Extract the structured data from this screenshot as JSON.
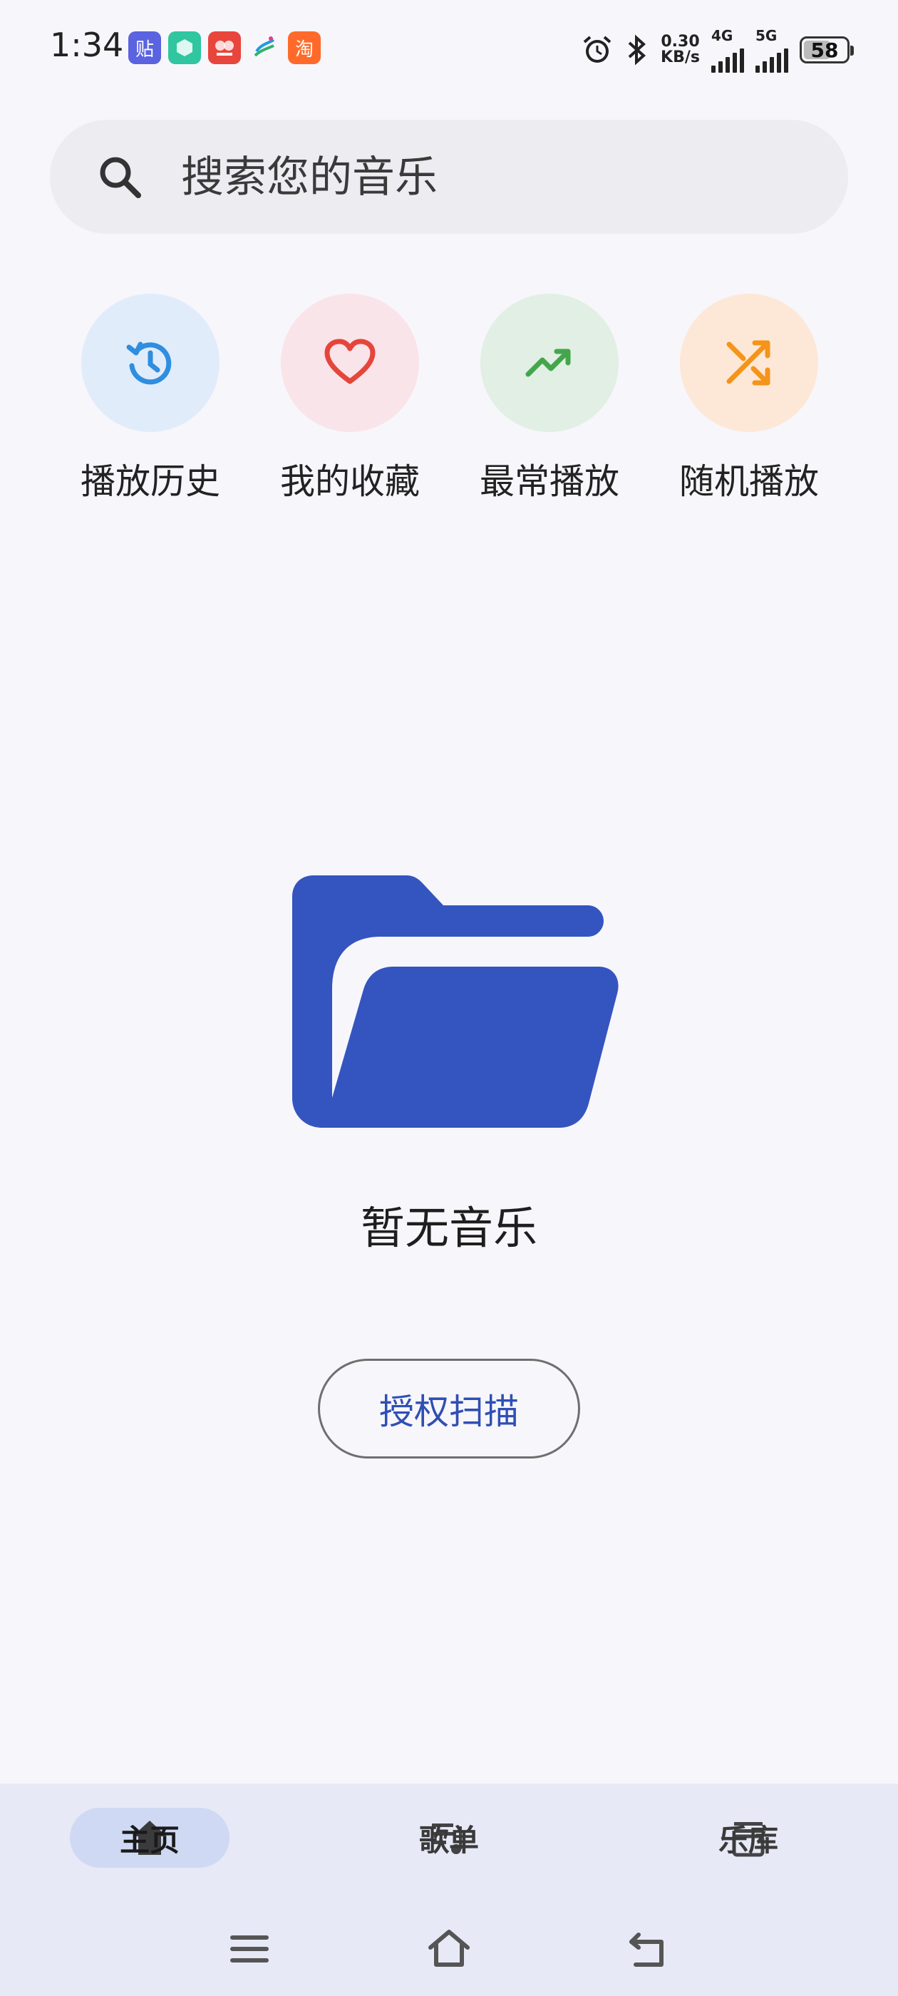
{
  "status_bar": {
    "time": "1:34",
    "app_icons": [
      {
        "name": "tieba-icon",
        "glyph": "贴",
        "bg": "#5a63e0"
      },
      {
        "name": "green-app-icon",
        "glyph": "",
        "bg": "#2fc6a0"
      },
      {
        "name": "red-app-icon",
        "glyph": "",
        "bg": "#e8453c"
      },
      {
        "name": "china-mobile-icon",
        "glyph": "",
        "bg": "#ffffff"
      },
      {
        "name": "taobao-icon",
        "glyph": "淘",
        "bg": "#ff6a2a"
      }
    ],
    "speed_value": "0.30",
    "speed_unit": "KB/s",
    "net1": "4G",
    "net2": "5G",
    "battery": "58"
  },
  "search": {
    "placeholder": "搜索您的音乐"
  },
  "quick_actions": [
    {
      "label": "播放历史",
      "icon": "history-icon",
      "bg": "#e1ecfb",
      "color": "#2f8ee0"
    },
    {
      "label": "我的收藏",
      "icon": "heart-icon",
      "bg": "#f9e4ea",
      "color": "#e5453b"
    },
    {
      "label": "最常播放",
      "icon": "trending-up-icon",
      "bg": "#e1efe4",
      "color": "#44a64c"
    },
    {
      "label": "随机播放",
      "icon": "shuffle-icon",
      "bg": "#fde8d8",
      "color": "#f5941a"
    }
  ],
  "empty_state": {
    "icon": "folder-open-icon",
    "message": "暂无音乐",
    "button": "授权扫描",
    "folder_color": "#3455bf"
  },
  "bottom_nav": {
    "items": [
      {
        "label": "主页",
        "icon": "home-icon",
        "active": true
      },
      {
        "label": "歌单",
        "icon": "playlist-icon",
        "active": false
      },
      {
        "label": "乐库",
        "icon": "library-icon",
        "active": false
      }
    ]
  },
  "system_nav": {
    "buttons": [
      "menu-icon",
      "home-outline-icon",
      "back-icon"
    ]
  }
}
